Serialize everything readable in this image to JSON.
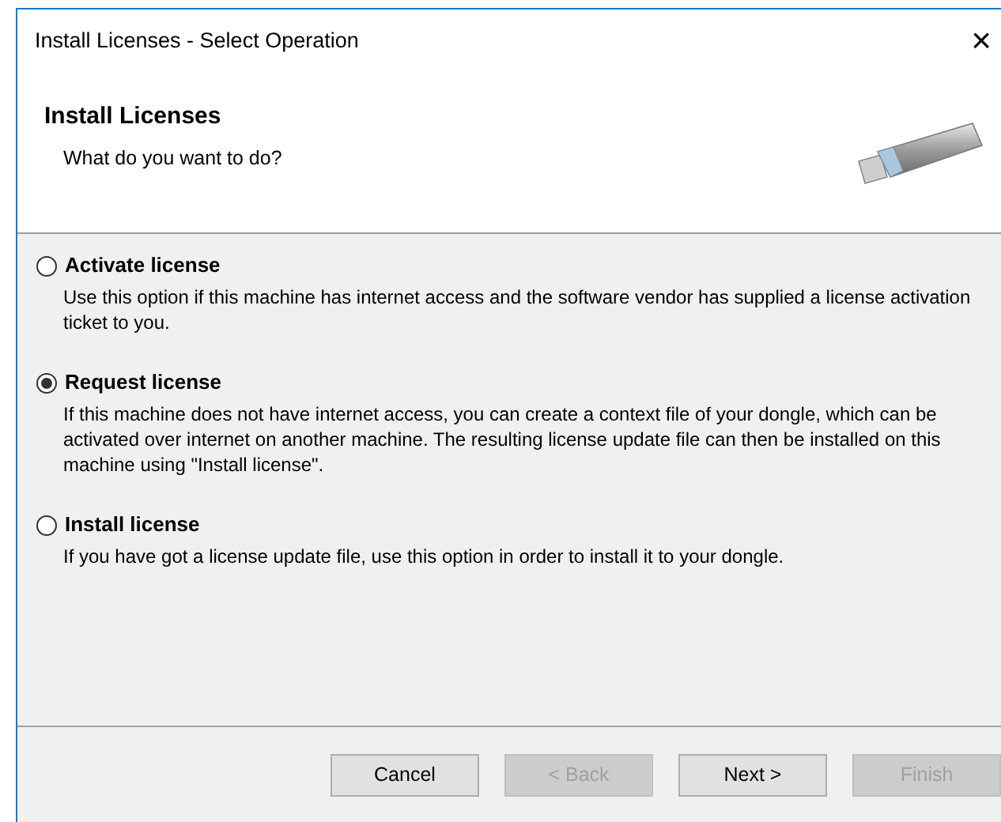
{
  "window": {
    "title": "Install Licenses - Select Operation",
    "close": "×"
  },
  "header": {
    "title": "Install Licenses",
    "subtitle": "What do you want to do?"
  },
  "options": [
    {
      "label": "Activate license",
      "selected": false,
      "description": "Use this option if this machine has internet access and the software vendor has supplied a license activation ticket to you."
    },
    {
      "label": "Request license",
      "selected": true,
      "description": "If this machine does not have internet access, you can create a context file of your dongle, which can be activated over internet on another machine. The resulting license update file can then be installed on this machine using \"Install license\"."
    },
    {
      "label": "Install license",
      "selected": false,
      "description": "If you have got a license update file, use this option in order to install it to your dongle."
    }
  ],
  "buttons": [
    {
      "label": "Cancel",
      "disabled": false
    },
    {
      "label": "< Back",
      "disabled": true
    },
    {
      "label": "Next >",
      "disabled": false
    },
    {
      "label": "Finish",
      "disabled": true
    }
  ]
}
